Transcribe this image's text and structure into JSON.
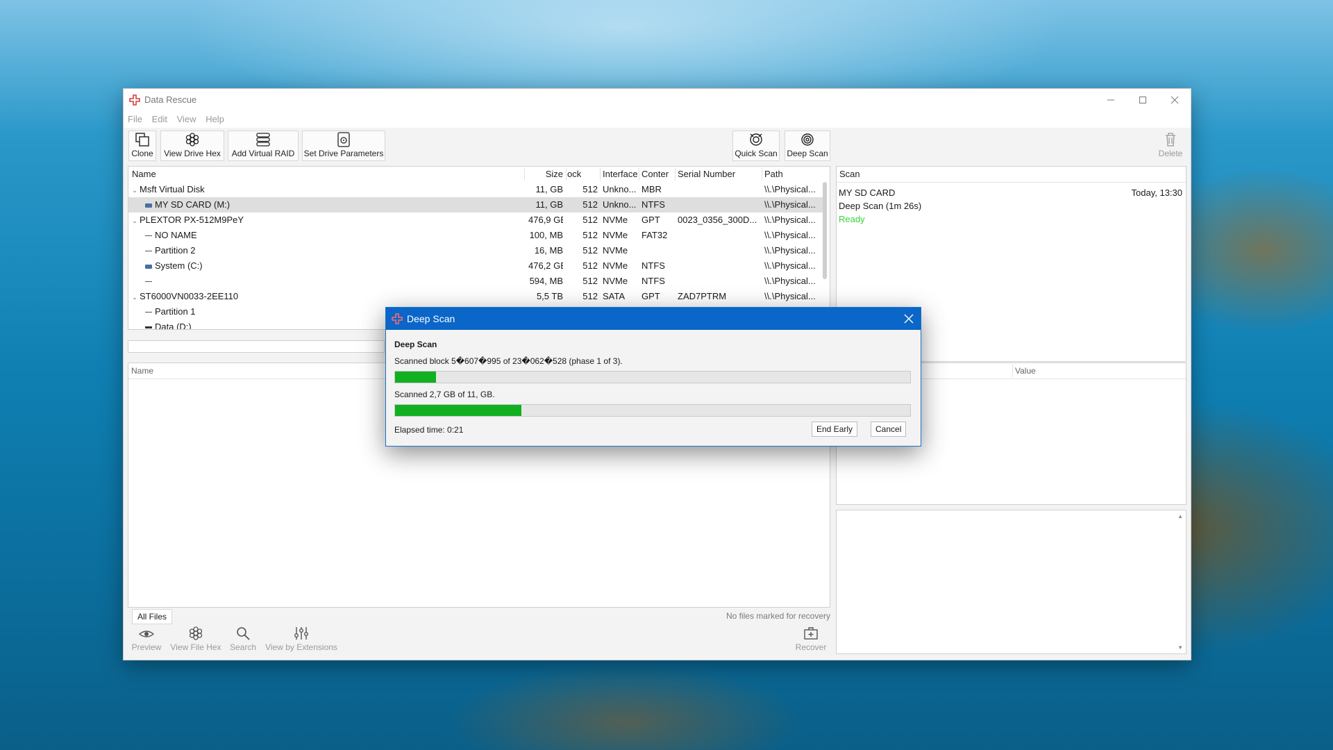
{
  "window": {
    "title": "Data Rescue"
  },
  "menu": [
    "File",
    "Edit",
    "View",
    "Help"
  ],
  "toolbar": {
    "clone": "Clone",
    "view_drive_hex": "View Drive Hex",
    "add_virtual_raid": "Add Virtual RAID",
    "set_drive_parameters": "Set Drive Parameters",
    "quick_scan": "Quick Scan",
    "deep_scan": "Deep Scan",
    "delete": "Delete"
  },
  "drives": {
    "columns": [
      "Name",
      "Size",
      "ock Size",
      "Interface",
      "Conter",
      "Serial Number",
      "Path"
    ],
    "rows": [
      {
        "name": "Msft Virtual Disk",
        "size": "11, GB",
        "block": "512",
        "iface": "Unkno...",
        "content": "MBR",
        "serial": "",
        "path": "\\\\.\\Physical..."
      },
      {
        "name": "MY SD CARD (M:)",
        "size": "11, GB",
        "block": "512",
        "iface": "Unkno...",
        "content": "NTFS",
        "serial": "",
        "path": "\\\\.\\Physical..."
      },
      {
        "name": "PLEXTOR PX-512M9PeY",
        "size": "476,9 GB",
        "block": "512",
        "iface": "NVMe",
        "content": "GPT",
        "serial": "0023_0356_300D...",
        "path": "\\\\.\\Physical..."
      },
      {
        "name": "NO NAME",
        "size": "100, MB",
        "block": "512",
        "iface": "NVMe",
        "content": "FAT32",
        "serial": "",
        "path": "\\\\.\\Physical..."
      },
      {
        "name": "Partition 2",
        "size": "16, MB",
        "block": "512",
        "iface": "NVMe",
        "content": "",
        "serial": "",
        "path": "\\\\.\\Physical..."
      },
      {
        "name": "System (C:)",
        "size": "476,2 GB",
        "block": "512",
        "iface": "NVMe",
        "content": "NTFS",
        "serial": "",
        "path": "\\\\.\\Physical..."
      },
      {
        "name": "",
        "size": "594, MB",
        "block": "512",
        "iface": "NVMe",
        "content": "NTFS",
        "serial": "",
        "path": "\\\\.\\Physical..."
      },
      {
        "name": "ST6000VN0033-2EE110",
        "size": "5,5 TB",
        "block": "512",
        "iface": "SATA",
        "content": "GPT",
        "serial": "ZAD7PTRM",
        "path": "\\\\.\\Physical..."
      },
      {
        "name": "Partition 1",
        "size": "",
        "block": "",
        "iface": "",
        "content": "",
        "serial": "",
        "path": ""
      },
      {
        "name": "Data (D:)",
        "size": "",
        "block": "",
        "iface": "",
        "content": "",
        "serial": "",
        "path": ""
      }
    ]
  },
  "scan_panel": {
    "header": "Scan",
    "drive_name": "MY SD CARD",
    "timestamp": "Today, 13:30",
    "scan_type": "Deep Scan (1m 26s)",
    "status": "Ready",
    "status_color": "#3cd23c"
  },
  "files": {
    "name_header": "Name",
    "value_header": "Value"
  },
  "bottom": {
    "tab": "All Files",
    "no_files": "No files marked for recovery",
    "preview": "Preview",
    "view_file_hex": "View File Hex",
    "search": "Search",
    "view_by_extensions": "View by Extensions",
    "recover": "Recover"
  },
  "dialog": {
    "title": "Deep Scan",
    "heading": "Deep Scan",
    "block_status": "Scanned block 5�607�995 of 23�062�528 (phase 1 of 3).",
    "block_progress": 0.08,
    "bytes_status": "Scanned 2,7 GB of 11, GB.",
    "bytes_progress": 0.245,
    "elapsed": "Elapsed time: 0:21",
    "end_early": "End Early",
    "cancel": "Cancel",
    "accent": "#0a66c8",
    "progress_color": "#11b020"
  }
}
